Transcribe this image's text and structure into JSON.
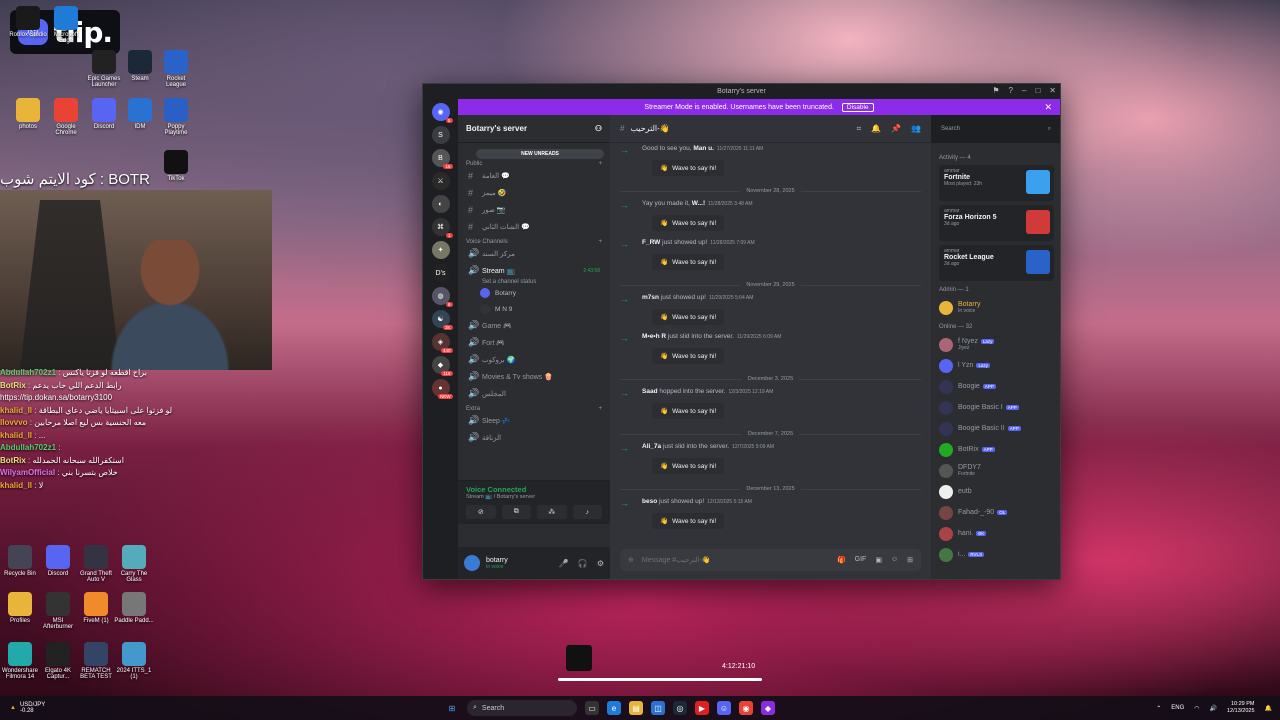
{
  "overlay": {
    "brand": "tiip.",
    "code_text": "كود الايتم شوب : BOTR"
  },
  "desktop_icons_top": [
    {
      "label": "Roblox Studio",
      "color": "#1a1a1a"
    },
    {
      "label": "Microsoft Edge",
      "color": "#1f7ad8"
    },
    {
      "label": "Epic Games Launcher",
      "color": "#222"
    },
    {
      "label": "Steam",
      "color": "#1b2838"
    },
    {
      "label": "Rocket League",
      "color": "#2a63c8"
    },
    {
      "label": "photos",
      "color": "#e8b53a"
    },
    {
      "label": "Google Chrome",
      "color": "#e94335"
    },
    {
      "label": "Discord",
      "color": "#5865f2"
    },
    {
      "label": "IDM",
      "color": "#2a72d1"
    },
    {
      "label": "Poppy Playtime",
      "color": "#2a60c6"
    },
    {
      "label": "TikTok",
      "color": "#111"
    }
  ],
  "chat": [
    {
      "user": "Abdullah702z1",
      "text": "براح اقطعه لو فزتا ياكنس",
      "color": "#4fd16b"
    },
    {
      "user": "BotRix",
      "text": "رابط الدعم اللي حاب يدعم",
      "color": "#e8e07a"
    },
    {
      "user": "",
      "text": "https://tip.dokan.sa/botarry3100",
      "color": "#ffffff"
    },
    {
      "user": "khalid_ll",
      "text": "لو فزتوا على اسبيتايا ياضي دعاي البطاقة",
      "color": "#f0a830"
    },
    {
      "user": "llovvvo",
      "text": "معه الحنسية بس ليع اصلا مرحابين",
      "color": "#f0a830"
    },
    {
      "user": "khalid_ll",
      "text": "...",
      "color": "#f0a830"
    },
    {
      "user": "Abdullah702z1",
      "text": "",
      "color": "#4fd16b"
    },
    {
      "user": "BotRix",
      "text": "استكفرالله سبحانه الحمدلله",
      "color": "#e8e07a"
    },
    {
      "user": "WilyamOfficial",
      "text": "خلاص بتسرنا بني",
      "color": "#e070f0"
    },
    {
      "user": "khalid_ll",
      "text": "لا",
      "color": "#f0a830"
    }
  ],
  "desktop_icons_bottom": [
    {
      "label": "Recycle Bin",
      "color": "#445"
    },
    {
      "label": "Discord",
      "color": "#5865f2"
    },
    {
      "label": "Grand Theft Auto V",
      "color": "#334"
    },
    {
      "label": "Carry The Glass",
      "color": "#5ab"
    },
    {
      "label": "Profiles",
      "color": "#e8b53a"
    },
    {
      "label": "MSI Afterburner",
      "color": "#333"
    },
    {
      "label": "FiveM (1)",
      "color": "#f08a2a"
    },
    {
      "label": "Paddle Padd...",
      "color": "#777"
    },
    {
      "label": "Wondershare Filmora 14",
      "color": "#2aa"
    },
    {
      "label": "Elgato 4K Captur...",
      "color": "#222"
    },
    {
      "label": "REMATCH BETA TEST",
      "color": "#346"
    },
    {
      "label": "2024 ITTS_1 (1)",
      "color": "#49c"
    }
  ],
  "window": {
    "title": "Botarry's server",
    "banner_text": "Streamer Mode is enabled. Usernames have been truncated.",
    "banner_button": "Disable",
    "server_name": "Botarry's server",
    "new_unreads": "NEW UNREADS",
    "categories": {
      "public": "Public",
      "voice": "Voice Channels",
      "extra": "Extra"
    },
    "public_channels": [
      "العامة 💬",
      "ميمز 🤣",
      "صور 📷",
      "الشات الثاني 💬"
    ],
    "voice_channels": [
      "مركز السند"
    ],
    "stream": {
      "name": "Stream 📺",
      "status": "Set a channel status",
      "time": "2:43:58",
      "users": [
        "Botarry",
        "M N 9"
      ]
    },
    "voice_more": [
      "Game 🎮",
      "Fort 🎮",
      "بروكوب 🌍",
      "Movies & Tv shows 🍿",
      "المجلس"
    ],
    "extra_channels": [
      "Sleep 💤",
      "الزناقة"
    ],
    "voice_connected": {
      "title": "Voice Connected",
      "sub": "Stream 📺 / Botarry's server"
    },
    "user": {
      "name": "botarry",
      "status": "In voice"
    },
    "chat_channel": "الترحيب-👋",
    "search_placeholder": "Search",
    "composer_placeholder": "Message #الترحيب-👋",
    "messages": [
      {
        "type": "sys",
        "text": "Good to see you, ",
        "user": "Man u.",
        "time": "11/27/2025 11:11 AM"
      },
      {
        "type": "wave",
        "label": "Wave to say hi!"
      },
      {
        "type": "date",
        "text": "November 28, 2025"
      },
      {
        "type": "sys",
        "text": "Yay you made it, ",
        "user": "W...!",
        "time": "11/28/2025 3:48 AM"
      },
      {
        "type": "wave",
        "label": "Wave to say hi!"
      },
      {
        "type": "sys",
        "user": "F_RW",
        "text": " just showed up!",
        "time": "11/28/2025 7:09 AM"
      },
      {
        "type": "wave",
        "label": "Wave to say hi!"
      },
      {
        "type": "date",
        "text": "November 29, 2025"
      },
      {
        "type": "sys",
        "user": "m7sn",
        "text": " just showed up!",
        "time": "11/29/2025 5:04 AM"
      },
      {
        "type": "wave",
        "label": "Wave to say hi!"
      },
      {
        "type": "sys",
        "user": "M•e•h R",
        "text": " just slid into the server.",
        "time": "11/29/2025 6:09 AM"
      },
      {
        "type": "wave",
        "label": "Wave to say hi!"
      },
      {
        "type": "date",
        "text": "December 3, 2025"
      },
      {
        "type": "sys",
        "user": "Saad",
        "text": " hopped into the server.",
        "time": "12/3/2025 12:19 AM"
      },
      {
        "type": "wave",
        "label": "Wave to say hi!"
      },
      {
        "type": "date",
        "text": "December 7, 2025"
      },
      {
        "type": "sys",
        "user": "Ali_7a",
        "text": " just slid into the server.",
        "time": "12/7/2025 9:09 AM"
      },
      {
        "type": "wave",
        "label": "Wave to say hi!"
      },
      {
        "type": "date",
        "text": "December 13, 2025"
      },
      {
        "type": "sys",
        "user": "beso",
        "text": " just showed up!",
        "time": "12/13/2025 5:15 AM"
      },
      {
        "type": "wave",
        "label": "Wave to say hi!"
      }
    ],
    "activity_header": "Activity — 4",
    "activities": [
      {
        "user": "ammar",
        "game": "Fortnite",
        "detail": "Most played: 23h",
        "color": "#3ba0f0"
      },
      {
        "user": "ammar",
        "game": "Forza Horizon 5",
        "detail": "3d ago",
        "color": "#d23a3a"
      },
      {
        "user": "ammar",
        "game": "Rocket League",
        "detail": "3d ago",
        "color": "#2a63c8"
      }
    ],
    "admin_header": "Admin — 1",
    "admins": [
      {
        "name": "Botarry",
        "status": "In voice",
        "color": "#e8b53a"
      }
    ],
    "online_header": "Online — 32",
    "online": [
      {
        "name": "f Nyez",
        "tag": "Lazy",
        "status": "Jiyez",
        "color": "#a67"
      },
      {
        "name": "l Yzn",
        "tag": "Lazy",
        "status": "",
        "color": "#5865f2"
      },
      {
        "name": "Boogie",
        "tag": "APP",
        "status": "",
        "color": "#335"
      },
      {
        "name": "Boogie Basic I",
        "tag": "APP",
        "status": "",
        "color": "#335"
      },
      {
        "name": "Boogie Basic II",
        "tag": "APP",
        "status": "",
        "color": "#335"
      },
      {
        "name": "BotRix",
        "tag": "APP",
        "status": "",
        "color": "#2a2"
      },
      {
        "name": "DFDY7",
        "tag": "",
        "status": "Fortnite",
        "color": "#555"
      },
      {
        "name": "eutb",
        "tag": "",
        "status": "",
        "color": "#eee"
      },
      {
        "name": "Fahad-_-90",
        "tag": "OL",
        "status": "",
        "color": "#744"
      },
      {
        "name": "hani.",
        "tag": "BK",
        "status": "",
        "color": "#a44"
      },
      {
        "name": "i...",
        "tag": "RVLS",
        "status": "",
        "color": "#474"
      }
    ]
  },
  "recorder": {
    "timer": "4:12:21:10"
  },
  "taskbar": {
    "weather": "USD/JPY",
    "weather_sub": "-0.28",
    "search": "Search",
    "lang": "ENG",
    "time": "10:29 PM",
    "date": "12/13/2025"
  }
}
